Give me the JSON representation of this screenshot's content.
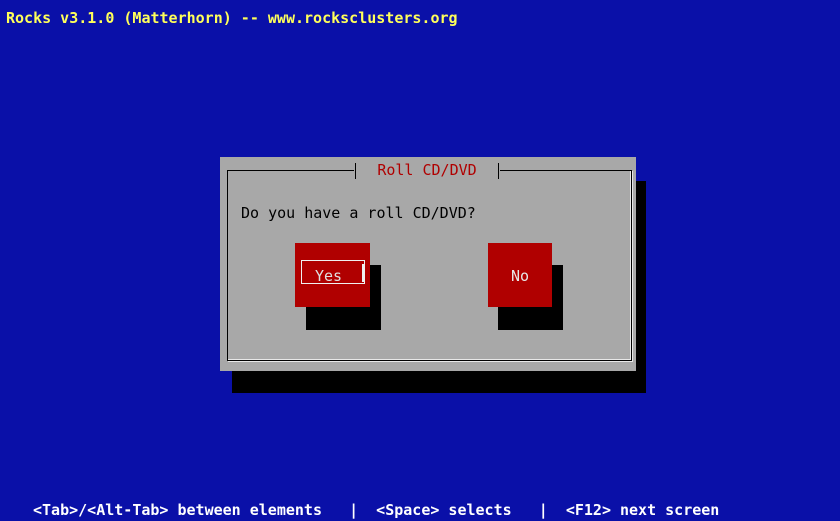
{
  "header": {
    "title": "Rocks v3.1.0 (Matterhorn) -- www.rocksclusters.org"
  },
  "dialog": {
    "title": "Roll CD/DVD",
    "prompt": "Do you have a roll CD/DVD?",
    "buttons": {
      "yes": "Yes",
      "no": "No"
    }
  },
  "status_bar": {
    "text": "<Tab>/<Alt-Tab> between elements   |  <Space> selects   |  <F12> next screen"
  },
  "colors": {
    "background": "#0a10a8",
    "title": "#ffff5a",
    "dialog": "#a8a8a8",
    "button": "#b00000",
    "dialog_title": "#b00000"
  }
}
